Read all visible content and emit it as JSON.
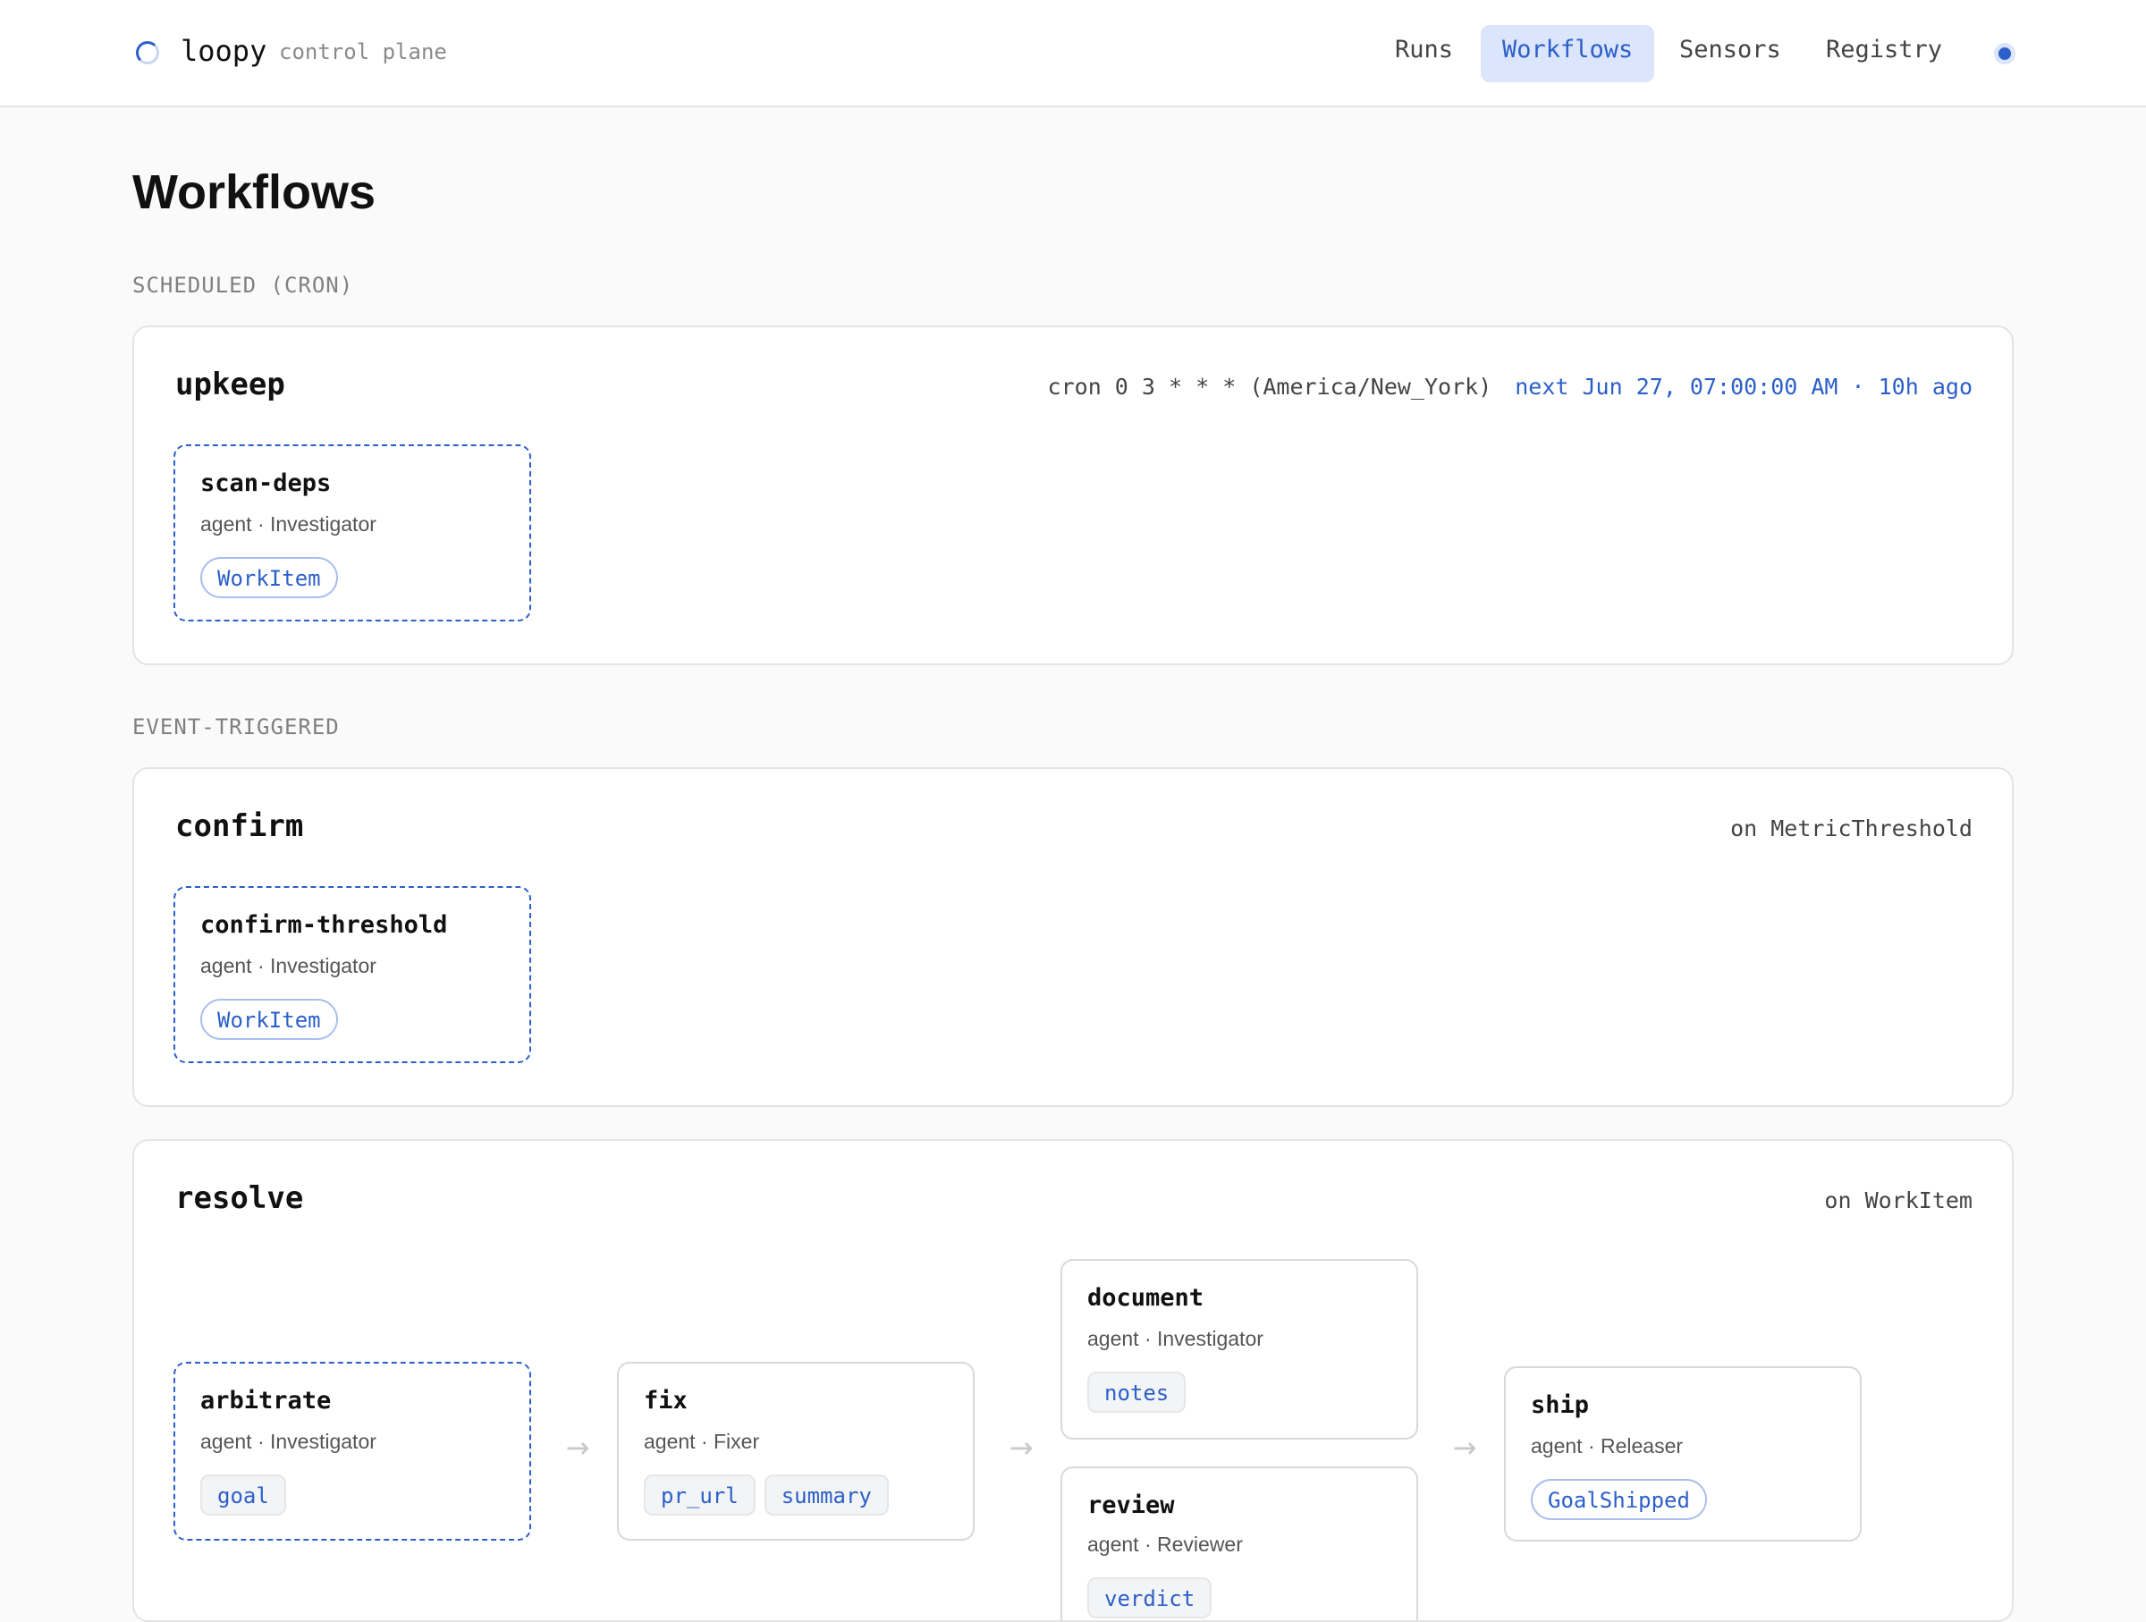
{
  "header": {
    "brand": "loopy",
    "subtitle": "control plane",
    "brand_icon": "loading-spinner-icon",
    "nav": [
      {
        "label": "Runs",
        "active": false
      },
      {
        "label": "Workflows",
        "active": true
      },
      {
        "label": "Sensors",
        "active": false
      },
      {
        "label": "Registry",
        "active": false
      }
    ],
    "status_icon": "status-dot-icon",
    "accent_color": "#2c5fc9"
  },
  "page": {
    "title": "Workflows"
  },
  "sections": {
    "scheduled": {
      "label": "SCHEDULED (CRON)",
      "workflows": [
        {
          "name": "upkeep",
          "trigger": "cron 0 3 * * * (America/New_York)",
          "next": "next Jun 27, 07:00:00 AM · 10h ago",
          "steps": [
            {
              "name": "scan-deps",
              "meta": "agent · Investigator",
              "tags": [
                "WorkItem"
              ]
            }
          ]
        }
      ]
    },
    "event": {
      "label": "EVENT-TRIGGERED",
      "workflows": [
        {
          "name": "confirm",
          "trigger": "on MetricThreshold",
          "steps": [
            {
              "name": "confirm-threshold",
              "meta": "agent · Investigator",
              "tags": [
                "WorkItem"
              ]
            }
          ]
        },
        {
          "name": "resolve",
          "trigger": "on WorkItem",
          "steps": [
            {
              "name": "arbitrate",
              "meta": "agent · Investigator",
              "tags": [
                "goal"
              ]
            },
            {
              "name": "fix",
              "meta": "agent · Fixer",
              "tags": [
                "pr_url",
                "summary"
              ]
            },
            {
              "name": "document",
              "meta": "agent · Investigator",
              "tags": [
                "notes"
              ]
            },
            {
              "name": "review",
              "meta": "agent · Reviewer",
              "tags": [
                "verdict"
              ]
            },
            {
              "name": "ship",
              "meta": "agent · Releaser",
              "tags": [
                "GoalShipped"
              ]
            }
          ],
          "arrow": "→"
        }
      ]
    }
  }
}
